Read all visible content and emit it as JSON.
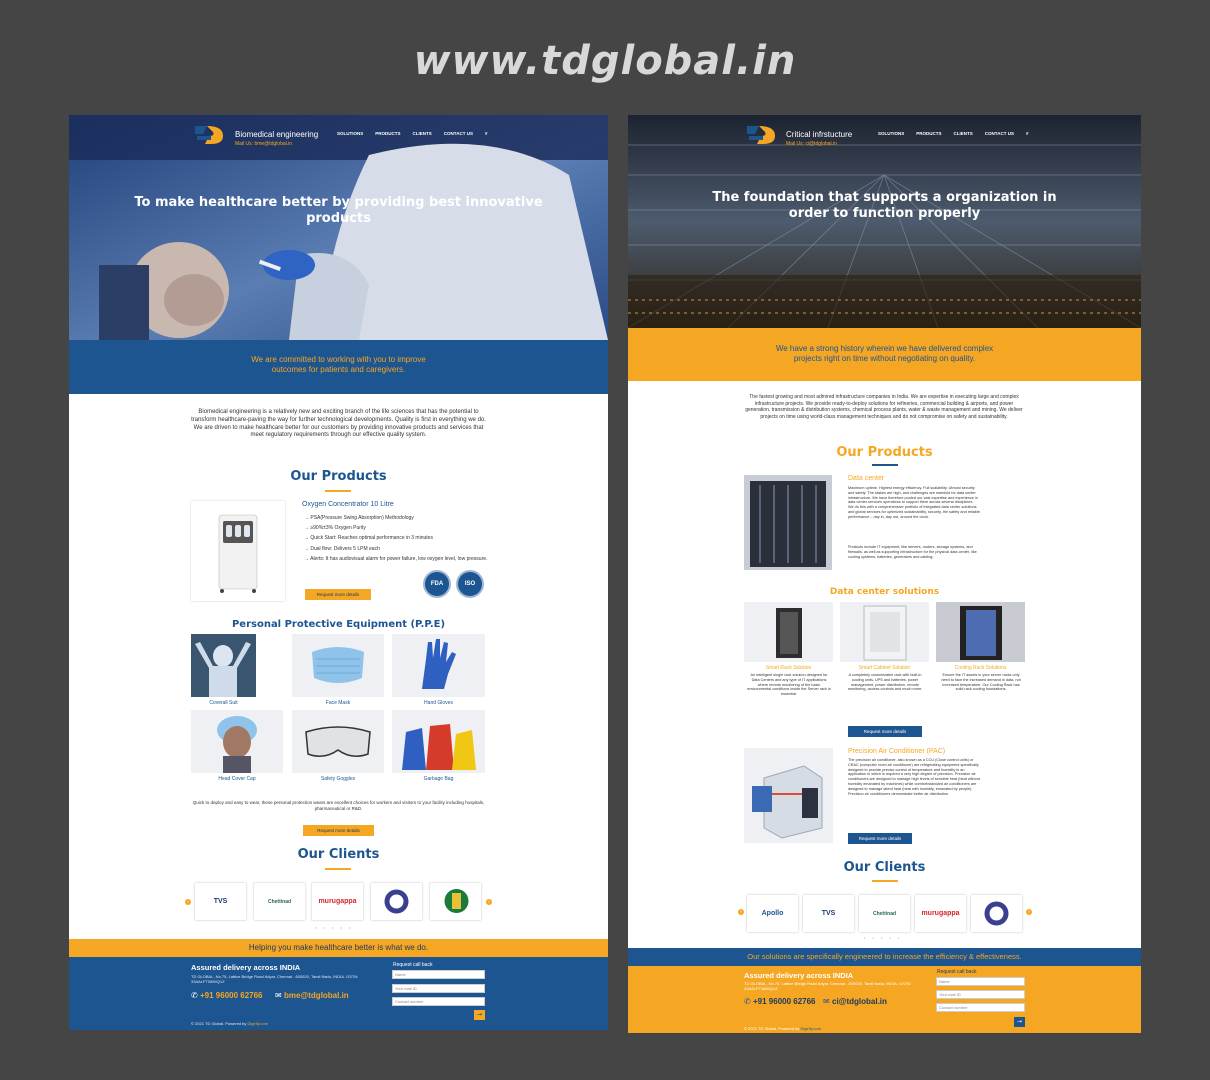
{
  "site_title": "www.tdglobal.in",
  "colors": {
    "blue": "#1d5590",
    "orange": "#f5a623",
    "bg": "#454545"
  },
  "left": {
    "brand_title": "Biomedical engineering",
    "brand_mail": "Mail Us: bme@tdglobal.in",
    "nav": [
      "SOLUTIONS",
      "PRODUCTS",
      "CLIENTS",
      "CONTACT US",
      "#"
    ],
    "hero_title": "To make healthcare better by providing best innovative products",
    "band_text": "We are committed to working with you to improve outcomes for patients and caregivers.",
    "intro": "Biomedical engineering is a relatively new and exciting branch of the life sciences that has the potential to transform healthcare-paving the way for further technological developments. Quality is first in everything we do. We are driven to make healthcare better for our customers by providing innovative products and services that meet regulatory requirements through our effective quality system.",
    "products_title": "Our Products",
    "product_name": "Oxygen Concentrator 10 Litre",
    "product_features": [
      "→ PSA(Pressure Swing Absorption) Methodology",
      "→ ≥90%±3% Oxygen Purity",
      "→ Quick Start: Reaches optimal performance in 3 minutes",
      "→ Dual flow: Delivers 5 LPM each",
      "→ Alerts: It has audiovisual alarm for power failure, low oxygen level, low pressure."
    ],
    "badge_fda": "FDA",
    "badge_iso": "ISO",
    "request_btn": "Request more details",
    "ppe_title": "Personal Protective Equipment (P.P.E)",
    "ppe_items": [
      "Coverall Suit",
      "Face Mask",
      "Hand Gloves",
      "Head Cover Cap",
      "Safety Goggles",
      "Garbage Bag"
    ],
    "ppe_desc": "Quick to deploy and easy to wear, these personal protection wears are excellent choices for workers and visitors to your facility including hospitals, pharmaceutical or R&D.",
    "request_btn2": "Request more details",
    "clients_title": "Our Clients",
    "clients": [
      "TVS",
      "Chettinad",
      "murugappa",
      "",
      ""
    ],
    "prev": "‹",
    "next": "›",
    "dots": "• • • • •",
    "footer_band": "Helping you make healthcare better is what we do.",
    "footer_heading": "Assured delivery across INDIA",
    "footer_address": "TD GLOBAL, No.75, Lattice Bridge Road Adyar, Chennai - 600020, Tamil Nadu, INDIA. GSTN: 33AALFT0880Q1Z",
    "phone": "+91 96000 62766",
    "email": "bme@tdglobal.in",
    "callback": "Request call back",
    "ph_name": "Name",
    "ph_mail": "Your mail ID",
    "ph_contact": "Contact number",
    "submit": "→",
    "copyright": "© 2021 TD Global. Powered by",
    "powered": "Digirify.com"
  },
  "right": {
    "brand_title": "Critical infrstucture",
    "brand_mail": "Mail Us: ci@tdglobal.in",
    "nav": [
      "SOLUTIONS",
      "PRODUCTS",
      "CLIENTS",
      "CONTACT US",
      "#"
    ],
    "hero_title": "The foundation that supports a organization in order to function properly",
    "band_text": "We have a strong history wherein we have delivered complex projects right on time without negotiating on quality.",
    "intro": "The fastest growing and most admired infrastructure companies in India. We are expertise in executing large and complex infrastructure projects. We provide ready-to-deploy solutions for refineries, commercial building & airports, and power generation, transmission & distribution systems, chemical process plants, water & waste management and mining. We deliver projects on time using world-class management techniques and do not compromise on safety and sustainability.",
    "products_title": "Our Products",
    "dc_title": "Data center",
    "dc_text": "Maximum uptime. Highest energy efficiency. Full scalability. Utmost security and safety. The stakes are high, and challenges are manifold for data center infrastructure. We have therefore pooled our vast expertise and experience in data center services operations to support them across several disciplines. We do this with a comprehensive portfolio of integrated data center solutions and global services for optimized sustainability, security, the safety and reliable performance – day in, day out, around the clock.",
    "dc_text2": "Products include IT equipment, like servers, routers, storage systems, and firewalls, as well as supporting infrastructure for the physical data center, like cooling systems, batteries, generators and cabling.",
    "dcs_title": "Data center solutions",
    "solutions": [
      {
        "name": "Smart Rack Solution",
        "desc": "An intelligent single rack solution designed for Data Centers and any type of IT applications where remote monitoring of the basic environmental conditions inside the Server rack is essential."
      },
      {
        "name": "Smart Cabinet Solution",
        "desc": "A completely customizable rack with built-in cooling units, UPS and batteries, power management, power distribution, remote monitoring, access controls and much more."
      },
      {
        "name": "Cooling Rack Solutions",
        "desc": "Ensure the IT assets in your server racks only need to face the increased demand in data, not increased temperature. Our Cooling Rack has solid rack cooling foundations."
      }
    ],
    "request_btn": "Request more details",
    "pac_title": "Precision Air Conditioner (PAC)",
    "pac_text": "The precision air conditioner, also known as a CCU (Close control units) or CRAC (computer room air conditioner) are refrigerating equipment specifically designed to provide precise control of temperature and humidity in an application in which is required a very high degree of precision. Precision air conditioners are designed to manage high levels of sensible heat (heat without humidity emanated by machines) while comfort/standard air conditioners are designed to manage latent heat (heat with humidity, emanated by people). Precision air conditioners demonstrate better air distribution.",
    "request_btn2": "Request more details",
    "clients_title": "Our Clients",
    "clients": [
      "Apollo",
      "TVS",
      "Chettinad",
      "murugappa",
      ""
    ],
    "prev": "‹",
    "next": "›",
    "dots": "• • • • •",
    "footer_band": "Our solutions are specifically engineered to increase the efficiency & effectiveness.",
    "footer_heading": "Assured delivery across INDIA",
    "footer_address": "TD GLOBAL, No.75, Lattice Bridge Road Adyar, Chennai - 600020, Tamil Nadu, INDIA. GSTN: 33AALFT0880Q1Z",
    "phone": "+91 96000 62766",
    "email": "ci@tdglobal.in",
    "callback": "Request call back",
    "ph_name": "Name",
    "ph_mail": "Your mail ID",
    "ph_contact": "Contact number",
    "submit": "→",
    "copyright": "© 2021 TD Global. Powered by",
    "powered": "Digirify.com"
  }
}
